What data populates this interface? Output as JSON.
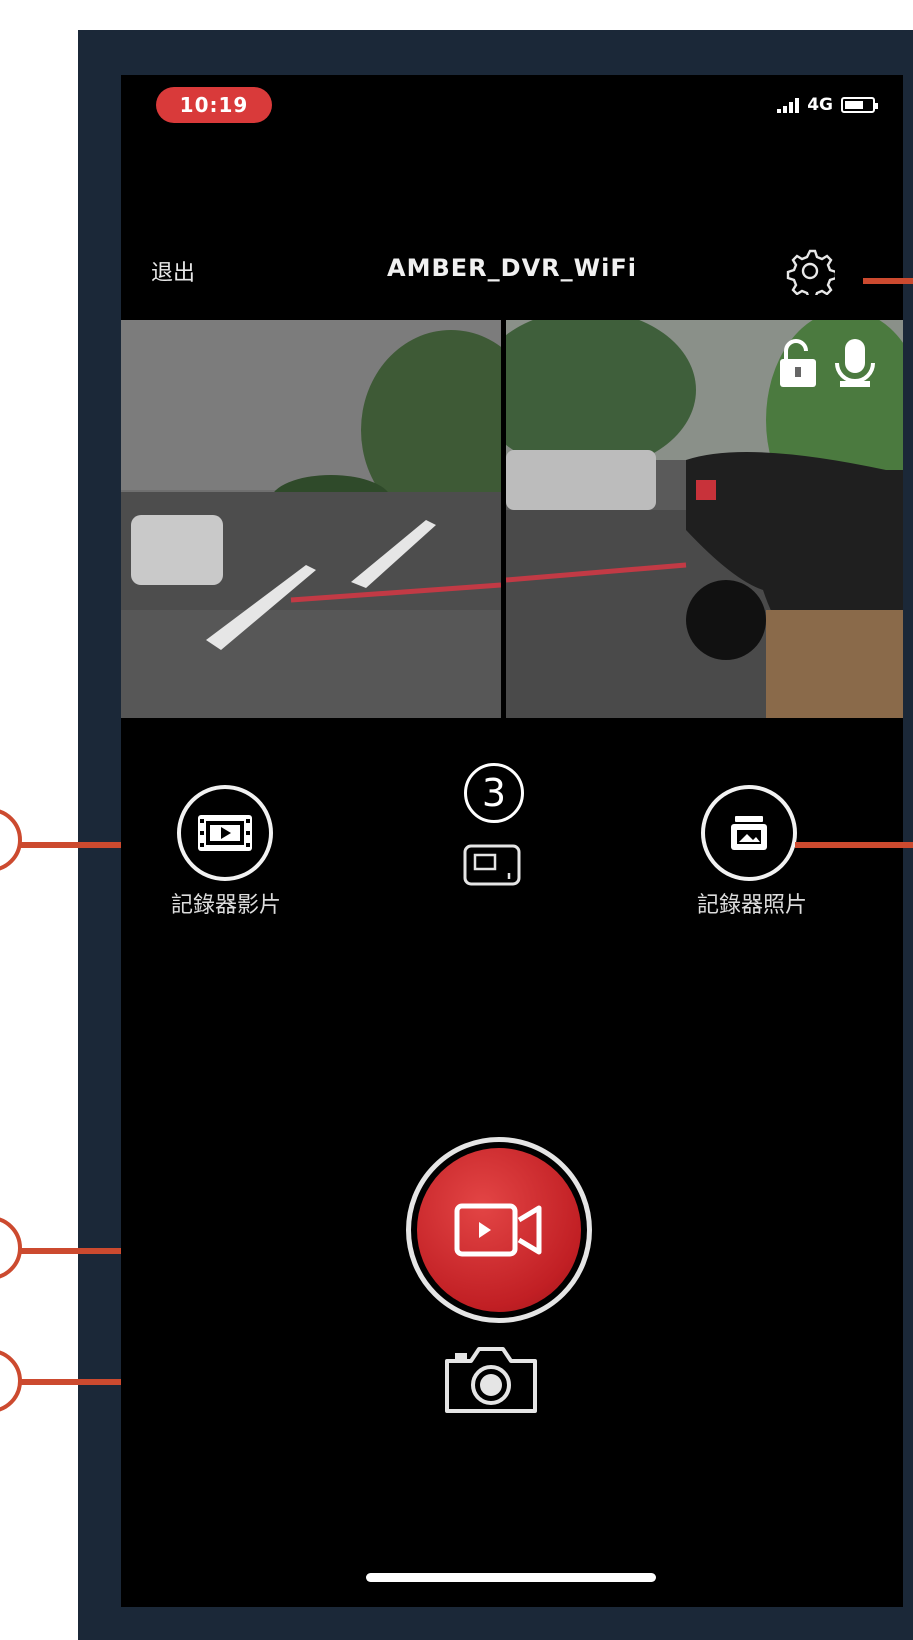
{
  "status_bar": {
    "time": "10:19",
    "network": "4G"
  },
  "nav": {
    "exit_label": "退出",
    "title": "AMBER_DVR_WiFi"
  },
  "controls": {
    "left_label": "記錄器影片",
    "right_label": "記錄器照片",
    "step_number": "3"
  },
  "icons": {
    "settings": "gear-icon",
    "lock": "unlock-icon",
    "microphone": "microphone-icon",
    "video_list": "film-icon",
    "photo_list": "photo-icon",
    "screen_toggle": "screen-switch-icon",
    "record": "video-camera-icon",
    "snapshot": "camera-icon"
  },
  "colors": {
    "accent": "#d93a3a",
    "callout": "#cc4a2f",
    "frame": "#1b2838"
  }
}
